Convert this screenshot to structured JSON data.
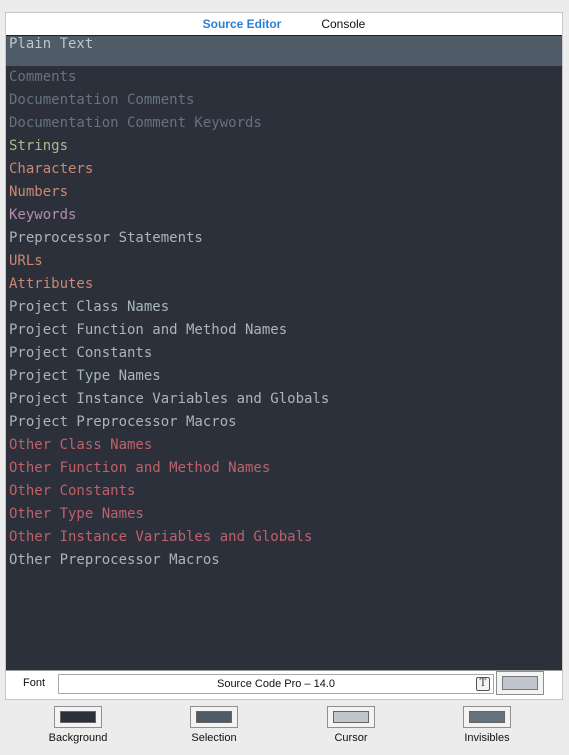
{
  "tabs": [
    {
      "label": "Source Editor",
      "active": true
    },
    {
      "label": "Console",
      "active": false
    }
  ],
  "syntax_items": [
    {
      "label": "Plain Text",
      "color": "#c0c5ce",
      "selected": true
    },
    {
      "label": "Comments",
      "color": "#65737e"
    },
    {
      "label": "Documentation Comments",
      "color": "#65737e"
    },
    {
      "label": "Documentation Comment Keywords",
      "color": "#65737e"
    },
    {
      "label": "Strings",
      "color": "#a3be8c"
    },
    {
      "label": "Characters",
      "color": "#d08770"
    },
    {
      "label": "Numbers",
      "color": "#d08770"
    },
    {
      "label": "Keywords",
      "color": "#b48ead"
    },
    {
      "label": "Preprocessor Statements",
      "color": "#a7b6bc"
    },
    {
      "label": "URLs",
      "color": "#d08770"
    },
    {
      "label": "Attributes",
      "color": "#d08770"
    },
    {
      "label": "Project Class Names",
      "color": "#a7b6bc"
    },
    {
      "label": "Project Function and Method Names",
      "color": "#a7b6bc"
    },
    {
      "label": "Project Constants",
      "color": "#a7b6bc"
    },
    {
      "label": "Project Type Names",
      "color": "#a7b6bc"
    },
    {
      "label": "Project Instance Variables and Globals",
      "color": "#a7b6bc"
    },
    {
      "label": "Project Preprocessor Macros",
      "color": "#a7b6bc"
    },
    {
      "label": "Other Class Names",
      "color": "#bf616a"
    },
    {
      "label": "Other Function and Method Names",
      "color": "#bf616a"
    },
    {
      "label": "Other Constants",
      "color": "#bf616a"
    },
    {
      "label": "Other Type Names",
      "color": "#bf616a"
    },
    {
      "label": "Other Instance Variables and Globals",
      "color": "#bf616a"
    },
    {
      "label": "Other Preprocessor Macros",
      "color": "#a7b6bc"
    }
  ],
  "font": {
    "label": "Font",
    "value": "Source Code Pro – 14.0",
    "picker_icon": "T",
    "color": "#c0c5ce"
  },
  "color_wells": [
    {
      "label": "Background",
      "color": "#2b303b"
    },
    {
      "label": "Selection",
      "color": "#4f5b66"
    },
    {
      "label": "Cursor",
      "color": "#c0c5ce"
    },
    {
      "label": "Invisibles",
      "color": "#65737e"
    }
  ],
  "theme": {
    "editor_background": "#2b303b",
    "accent": "#2b7fd6"
  }
}
